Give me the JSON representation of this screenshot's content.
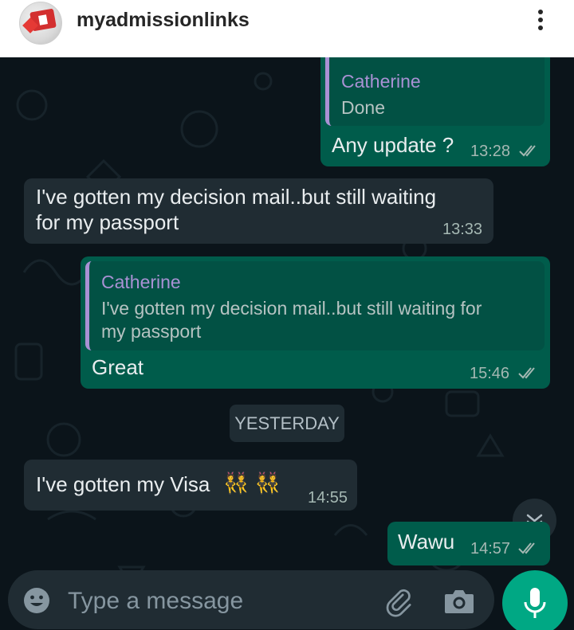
{
  "post_header": {
    "account_name": "myadmissionlinks",
    "avatar_icon": "canada-flag-keyboard-icon",
    "menu_icon": "more-options-icon"
  },
  "chat": {
    "messages": [
      {
        "direction": "outgoing",
        "quoted_name": "Catherine",
        "quoted_text": "Done",
        "text": "Any update ?",
        "time": "13:28",
        "status": "read"
      },
      {
        "direction": "incoming",
        "text_line1": "I've gotten my decision mail..but still waiting",
        "text_line2": "for my passport",
        "time": "13:33"
      },
      {
        "direction": "outgoing",
        "quoted_name": "Catherine",
        "quoted_line1": "I've gotten my decision mail..but still waiting for",
        "quoted_line2": "my passport",
        "text": "Great",
        "time": "15:46",
        "status": "read"
      },
      {
        "direction": "incoming",
        "text": "I've gotten my Visa",
        "emoji": "👯 👯",
        "time": "14:55"
      },
      {
        "direction": "outgoing",
        "text": "Wawu",
        "time": "14:57",
        "status": "read"
      }
    ],
    "date_divider": "YESTERDAY",
    "scroll_down_icon": "double-chevron-down-icon"
  },
  "composer": {
    "placeholder": "Type a message",
    "emoji_icon": "emoji-icon",
    "attach_icon": "paperclip-icon",
    "camera_icon": "camera-icon",
    "mic_icon": "microphone-icon"
  },
  "colors": {
    "chat_background": "#0b141a",
    "outgoing_bubble": "#005c4b",
    "incoming_bubble": "#202c33",
    "quote_accent": "#a991d4",
    "send_button": "#00a884"
  }
}
